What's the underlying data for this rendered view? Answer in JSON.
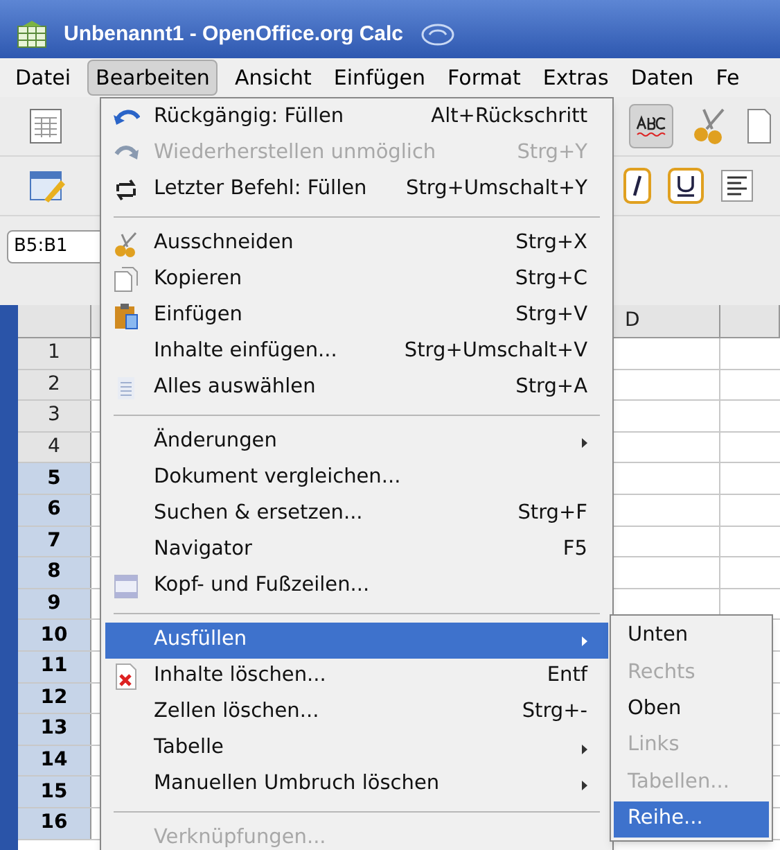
{
  "window": {
    "title": "Unbenannt1 - OpenOffice.org Calc"
  },
  "menubar": [
    {
      "label": "Datei",
      "selected": false
    },
    {
      "label": "Bearbeiten",
      "selected": true
    },
    {
      "label": "Ansicht",
      "selected": false
    },
    {
      "label": "Einfügen",
      "selected": false
    },
    {
      "label": "Format",
      "selected": false
    },
    {
      "label": "Extras",
      "selected": false
    },
    {
      "label": "Daten",
      "selected": false
    },
    {
      "label": "Fe",
      "selected": false
    }
  ],
  "name_box": {
    "value": "B5:B1"
  },
  "sheet": {
    "columns": [
      "D",
      ""
    ],
    "rows": [
      {
        "label": "1",
        "selected": false
      },
      {
        "label": "2",
        "selected": false
      },
      {
        "label": "3",
        "selected": false
      },
      {
        "label": "4",
        "selected": false
      },
      {
        "label": "5",
        "selected": true
      },
      {
        "label": "6",
        "selected": true
      },
      {
        "label": "7",
        "selected": true
      },
      {
        "label": "8",
        "selected": true
      },
      {
        "label": "9",
        "selected": true
      },
      {
        "label": "10",
        "selected": true
      },
      {
        "label": "11",
        "selected": true
      },
      {
        "label": "12",
        "selected": true
      },
      {
        "label": "13",
        "selected": true
      },
      {
        "label": "14",
        "selected": true
      },
      {
        "label": "15",
        "selected": true
      },
      {
        "label": "16",
        "selected": true
      }
    ]
  },
  "edit_menu": [
    {
      "kind": "item",
      "label": "Rückgängig: Füllen",
      "shortcut": "Alt+Rückschritt",
      "disabled": false,
      "submenu": false,
      "selected": false
    },
    {
      "kind": "item",
      "label": "Wiederherstellen unmöglich",
      "shortcut": "Strg+Y",
      "disabled": true,
      "submenu": false,
      "selected": false
    },
    {
      "kind": "item",
      "label": "Letzter Befehl: Füllen",
      "shortcut": "Strg+Umschalt+Y",
      "disabled": false,
      "submenu": false,
      "selected": false
    },
    {
      "kind": "separator"
    },
    {
      "kind": "item",
      "label": "Ausschneiden",
      "shortcut": "Strg+X",
      "disabled": false,
      "submenu": false,
      "selected": false
    },
    {
      "kind": "item",
      "label": "Kopieren",
      "shortcut": "Strg+C",
      "disabled": false,
      "submenu": false,
      "selected": false
    },
    {
      "kind": "item",
      "label": "Einfügen",
      "shortcut": "Strg+V",
      "disabled": false,
      "submenu": false,
      "selected": false
    },
    {
      "kind": "item",
      "label": "Inhalte einfügen...",
      "shortcut": "Strg+Umschalt+V",
      "disabled": false,
      "submenu": false,
      "selected": false
    },
    {
      "kind": "item",
      "label": "Alles auswählen",
      "shortcut": "Strg+A",
      "disabled": false,
      "submenu": false,
      "selected": false
    },
    {
      "kind": "separator"
    },
    {
      "kind": "item",
      "label": "Änderungen",
      "disabled": false,
      "submenu": true,
      "selected": false
    },
    {
      "kind": "item",
      "label": "Dokument vergleichen...",
      "disabled": false,
      "submenu": false,
      "selected": false
    },
    {
      "kind": "item",
      "label": "Suchen & ersetzen...",
      "shortcut": "Strg+F",
      "disabled": false,
      "submenu": false,
      "selected": false
    },
    {
      "kind": "item",
      "label": "Navigator",
      "shortcut": "F5",
      "disabled": false,
      "submenu": false,
      "selected": false
    },
    {
      "kind": "item",
      "label": "Kopf- und Fußzeilen...",
      "disabled": false,
      "submenu": false,
      "selected": false
    },
    {
      "kind": "separator"
    },
    {
      "kind": "item",
      "label": "Ausfüllen",
      "disabled": false,
      "submenu": true,
      "selected": true
    },
    {
      "kind": "item",
      "label": "Inhalte löschen...",
      "shortcut": "Entf",
      "disabled": false,
      "submenu": false,
      "selected": false
    },
    {
      "kind": "item",
      "label": "Zellen löschen...",
      "shortcut": "Strg+-",
      "disabled": false,
      "submenu": false,
      "selected": false
    },
    {
      "kind": "item",
      "label": "Tabelle",
      "disabled": false,
      "submenu": true,
      "selected": false
    },
    {
      "kind": "item",
      "label": "Manuellen Umbruch löschen",
      "disabled": false,
      "submenu": true,
      "selected": false
    },
    {
      "kind": "separator"
    },
    {
      "kind": "item",
      "label": "Verknüpfungen...",
      "disabled": true,
      "submenu": false,
      "selected": false
    }
  ],
  "fill_submenu": [
    {
      "label": "Unten",
      "disabled": false,
      "selected": false
    },
    {
      "label": "Rechts",
      "disabled": true,
      "selected": false
    },
    {
      "label": "Oben",
      "disabled": false,
      "selected": false
    },
    {
      "label": "Links",
      "disabled": true,
      "selected": false
    },
    {
      "label": "Tabellen...",
      "disabled": true,
      "selected": false
    },
    {
      "label": "Reihe...",
      "disabled": false,
      "selected": true
    }
  ]
}
